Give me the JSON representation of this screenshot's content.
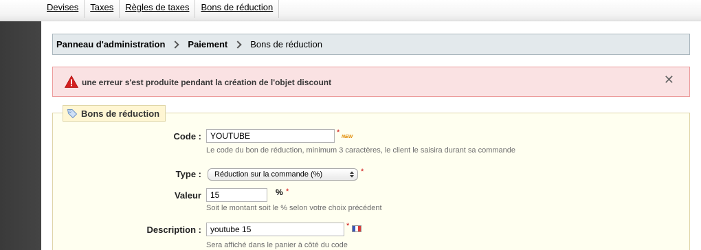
{
  "top_tabs": [
    "Devises",
    "Taxes",
    "Règles de taxes",
    "Bons de réduction"
  ],
  "breadcrumb": {
    "items": [
      "Panneau d'administration",
      "Paiement",
      "Bons de réduction"
    ]
  },
  "error": {
    "message": "une erreur s'est produite pendant la création de l'objet discount",
    "close_label": "✕"
  },
  "form": {
    "legend": "Bons de réduction",
    "code": {
      "label": "Code :",
      "value": "YOUTUBE",
      "required_mark": "*",
      "badge": "NEW",
      "hint": "Le code du bon de réduction, minimum 3 caractères, le client le saisira durant sa commande"
    },
    "type": {
      "label": "Type :",
      "selected": "Réduction sur la commande (%)",
      "required_mark": "*"
    },
    "valeur": {
      "label": "Valeur",
      "value": "15",
      "unit": "%",
      "required_mark": "*",
      "hint": "Soit le montant soit le % selon votre choix précédent"
    },
    "description": {
      "label": "Description :",
      "value": "youtube 15",
      "required_mark": "*",
      "hint": "Sera affiché dans le panier à côté du code"
    }
  },
  "colors": {
    "sidebar": "#3f3f3f",
    "breadcrumb_bg": "#e3e9ec",
    "error_bg": "#fae2e3",
    "error_icon": "#d42020",
    "fieldset_bg": "#fffff0",
    "required": "#cc0000",
    "flag_blue": "#3a57b8",
    "flag_red": "#d83a3a"
  }
}
